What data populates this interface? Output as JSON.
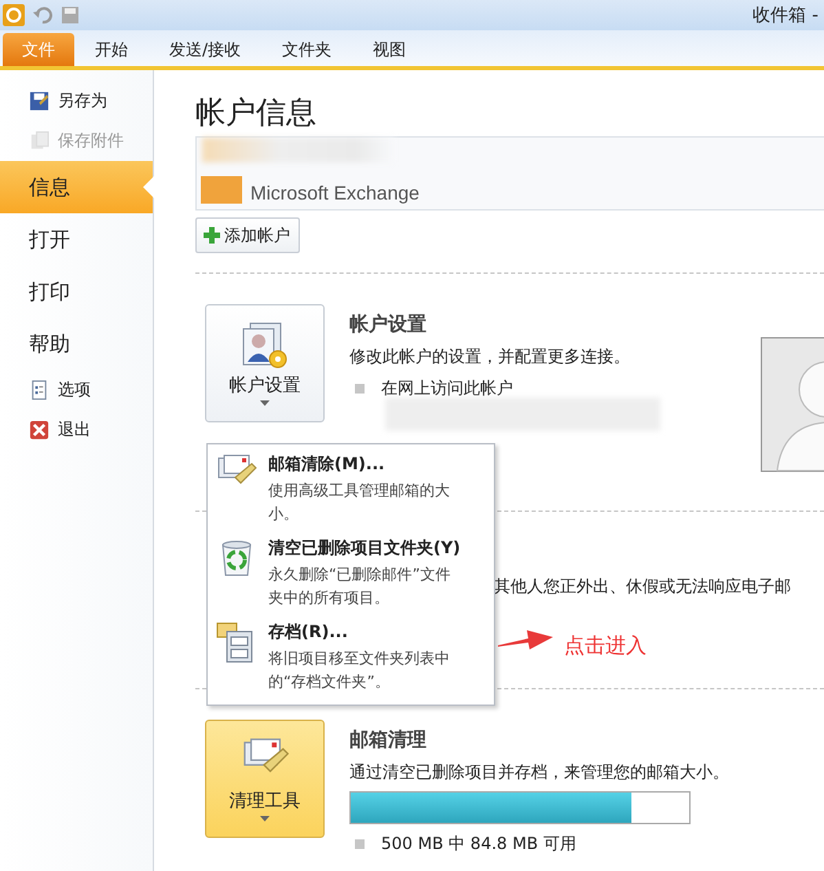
{
  "window": {
    "title": "收件箱 -"
  },
  "tabs": [
    {
      "label": "文件",
      "selected": true
    },
    {
      "label": "开始",
      "selected": false
    },
    {
      "label": "发送/接收",
      "selected": false
    },
    {
      "label": "文件夹",
      "selected": false
    },
    {
      "label": "视图",
      "selected": false
    }
  ],
  "sidebar": {
    "items": [
      {
        "kind": "small",
        "label": "另存为",
        "disabled": false,
        "selected": false
      },
      {
        "kind": "small",
        "label": "保存附件",
        "disabled": true,
        "selected": false
      },
      {
        "kind": "big",
        "label": "信息",
        "disabled": false,
        "selected": true
      },
      {
        "kind": "big",
        "label": "打开",
        "disabled": false,
        "selected": false
      },
      {
        "kind": "big",
        "label": "打印",
        "disabled": false,
        "selected": false
      },
      {
        "kind": "big",
        "label": "帮助",
        "disabled": false,
        "selected": false
      },
      {
        "kind": "small",
        "label": "选项",
        "disabled": false,
        "selected": false
      },
      {
        "kind": "small",
        "label": "退出",
        "disabled": false,
        "selected": false
      }
    ]
  },
  "page_title": "帐户信息",
  "account": {
    "type": "Microsoft Exchange"
  },
  "add_account_button": "添加帐户",
  "account_settings": {
    "button": "帐户设置",
    "heading": "帐户设置",
    "description": "修改此帐户的设置，并配置更多连接。",
    "bullet": "在网上访问此帐户"
  },
  "auto_reply": {
    "description": "其他人您正外出、休假或无法响应电子邮"
  },
  "cleanup": {
    "button": "清理工具",
    "heading": "邮箱清理",
    "description": "通过清空已删除项目并存档，来管理您的邮箱大小。",
    "level": 0.83,
    "reading": "500 MB 中 84.8 MB 可用"
  },
  "menu": [
    {
      "title": "邮箱清除(M)...",
      "description": "使用高级工具管理邮箱的大小。"
    },
    {
      "title": "清空已删除项目文件夹(Y)",
      "description": "永久删除“已删除邮件”文件夹中的所有项目。"
    },
    {
      "title": "存档(R)...",
      "description": "将旧项目移至文件夹列表中的“存档文件夹”。"
    }
  ],
  "annotation": "点击进入"
}
